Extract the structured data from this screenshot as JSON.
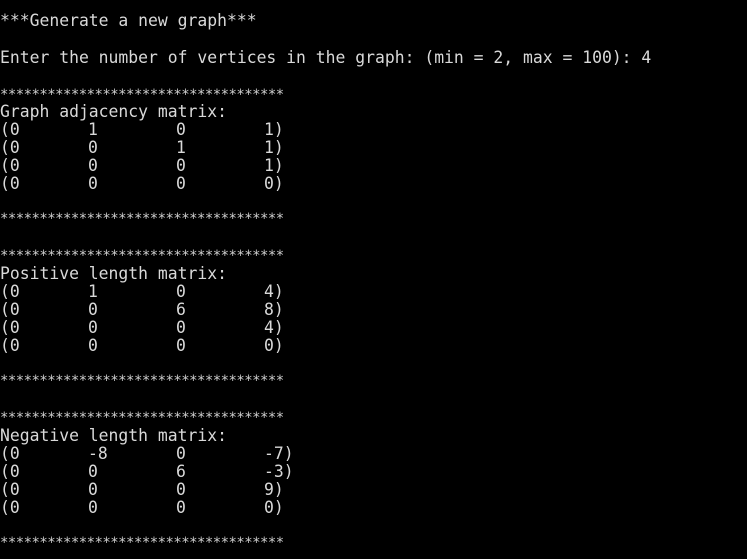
{
  "window": {
    "title_line": "***Generate a new graph***",
    "prompt_line": "Enter the number of vertices in the graph: (min = 2, max = 100): 4"
  },
  "separator": "************************************",
  "sections": [
    {
      "title": "Graph adjacency matrix:",
      "rows": [
        [
          "(0",
          "1",
          "0",
          "1)"
        ],
        [
          "(0",
          "0",
          "1",
          "1)"
        ],
        [
          "(0",
          "0",
          "0",
          "1)"
        ],
        [
          "(0",
          "0",
          "0",
          "0)"
        ]
      ]
    },
    {
      "title": "Positive length matrix:",
      "rows": [
        [
          "(0",
          "1",
          "0",
          "4)"
        ],
        [
          "(0",
          "0",
          "6",
          "8)"
        ],
        [
          "(0",
          "0",
          "0",
          "4)"
        ],
        [
          "(0",
          "0",
          "0",
          "0)"
        ]
      ]
    },
    {
      "title": "Negative length matrix:",
      "rows": [
        [
          "(0",
          "-8",
          "0",
          "-7)"
        ],
        [
          "(0",
          "0",
          "6",
          "-3)"
        ],
        [
          "(0",
          "0",
          "0",
          "9)"
        ],
        [
          "(0",
          "0",
          "0",
          "0)"
        ]
      ]
    }
  ]
}
